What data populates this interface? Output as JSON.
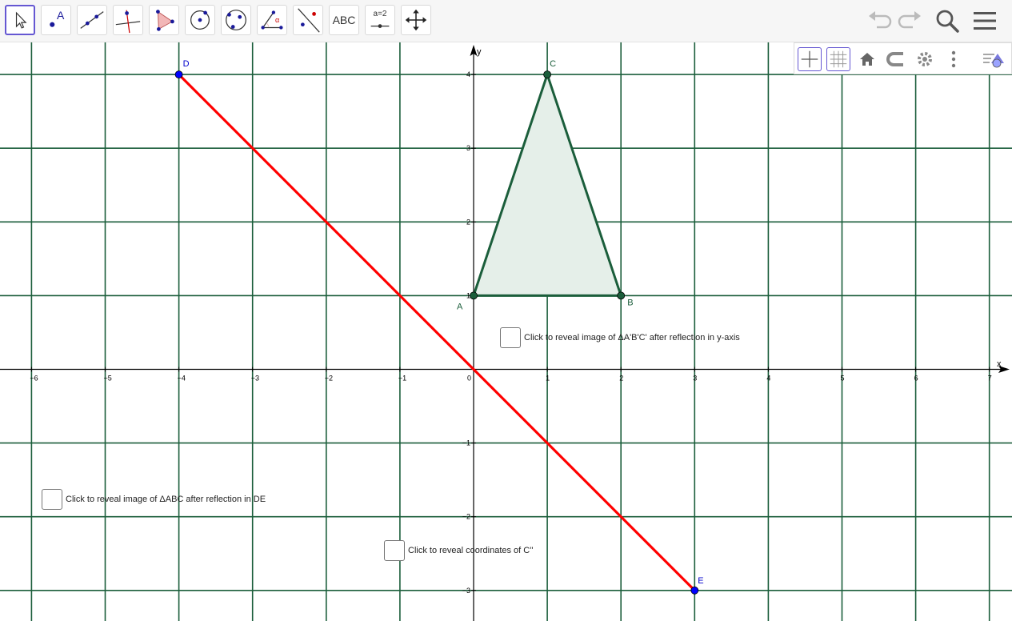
{
  "toolbar": {
    "tools": [
      {
        "name": "move-tool",
        "icon": "arrow-cursor-icon"
      },
      {
        "name": "point-tool",
        "icon": "point-icon",
        "label": "A"
      },
      {
        "name": "line-tool",
        "icon": "line-through-points-icon"
      },
      {
        "name": "perpendicular-line-tool",
        "icon": "perpendicular-line-icon"
      },
      {
        "name": "polygon-tool",
        "icon": "polygon-icon"
      },
      {
        "name": "circle-center-point-tool",
        "icon": "circle-center-icon"
      },
      {
        "name": "circle-three-points-tool",
        "icon": "circle-three-points-icon"
      },
      {
        "name": "angle-tool",
        "icon": "angle-icon",
        "label": "α"
      },
      {
        "name": "reflect-tool",
        "icon": "reflect-icon"
      },
      {
        "name": "text-tool",
        "icon": "text-icon",
        "label": "ABC"
      },
      {
        "name": "slider-tool",
        "icon": "slider-icon",
        "label": "a=2"
      },
      {
        "name": "move-view-tool",
        "icon": "move-graphics-view-icon"
      }
    ],
    "right_icons": [
      "undo-icon",
      "redo-icon",
      "search-icon",
      "menu-icon"
    ]
  },
  "graphics_panel": {
    "icons": [
      "axes-toggle-icon",
      "grid-toggle-icon",
      "home-icon",
      "point-capturing-icon",
      "settings-gear-icon",
      "more-vertical-icon",
      "style-bar-toggle-icon"
    ]
  },
  "graph": {
    "x_ticks": [
      "−6",
      "−5",
      "−4",
      "−3",
      "−2",
      "−1",
      "0",
      "1",
      "2",
      "3",
      "4",
      "5",
      "6",
      "7"
    ],
    "y_ticks": [
      "4",
      "3",
      "2",
      "1",
      "−1",
      "−2",
      "−3"
    ],
    "x_axis_label": "x",
    "y_axis_label": "y",
    "points": [
      {
        "label": "A",
        "x": 0,
        "y": 1
      },
      {
        "label": "B",
        "x": 2,
        "y": 1
      },
      {
        "label": "C",
        "x": 1,
        "y": 4
      },
      {
        "label": "D",
        "x": -4,
        "y": 4
      },
      {
        "label": "E",
        "x": 3,
        "y": -3
      }
    ],
    "triangle": [
      "A",
      "B",
      "C"
    ],
    "segment": [
      "D",
      "E"
    ],
    "colors": {
      "grid": "#1b5e3b",
      "triangle_stroke": "#1b5e3b",
      "triangle_fill": "#e5efe9",
      "segment": "#ff0000",
      "free_point": "#0000ff"
    }
  },
  "checkboxes": [
    {
      "label": "Click to reveal image of ΔA'B'C' after reflection in y-axis",
      "checked": false
    },
    {
      "label": "Click to reveal image of ΔABC after reflection in DE",
      "checked": false
    },
    {
      "label": "Click to reveal coordinates of C''",
      "checked": false
    }
  ]
}
